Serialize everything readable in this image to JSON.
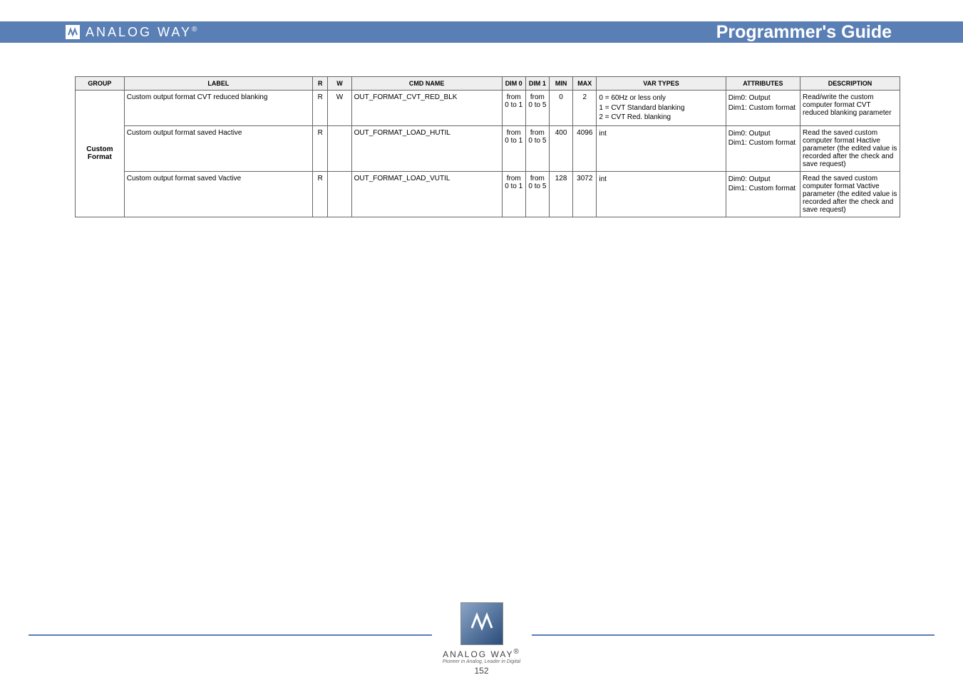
{
  "header": {
    "brand": "ANALOG WAY",
    "brand_reg": "®",
    "title": "Programmer's Guide"
  },
  "table": {
    "headers": {
      "group": "GROUP",
      "label": "LABEL",
      "r": "R",
      "w": "W",
      "cmd": "CMD NAME",
      "dim0": "DIM 0",
      "dim1": "DIM 1",
      "min": "MIN",
      "max": "MAX",
      "types": "VAR TYPES",
      "attr": "ATTRIBUTES",
      "desc": "DESCRIPTION"
    },
    "group_label": "Custom Format",
    "rows": [
      {
        "label": "Custom output format  CVT reduced blanking",
        "r": "R",
        "w": "W",
        "cmd": "OUT_FORMAT_CVT_RED_BLK",
        "dim0": "from 0 to 1",
        "dim1": "from 0 to 5",
        "min": "0",
        "max": "2",
        "types": "0 = 60Hz or less only\n1 = CVT Standard blanking\n2 = CVT Red. blanking",
        "attr": "Dim0: Output\nDim1: Custom format",
        "desc": "Read/write the custom computer format CVT reduced blanking parameter"
      },
      {
        "label": "Custom output format saved Hactive",
        "r": "R",
        "w": "",
        "cmd": "OUT_FORMAT_LOAD_HUTIL",
        "dim0": "from 0 to 1",
        "dim1": "from 0 to 5",
        "min": "400",
        "max": "4096",
        "types": "int",
        "attr": "Dim0: Output\nDim1: Custom format",
        "desc": "Read the saved custom computer format Hactive parameter (the edited value is recorded after the check and save request)"
      },
      {
        "label": "Custom output format saved Vactive",
        "r": "R",
        "w": "",
        "cmd": "OUT_FORMAT_LOAD_VUTIL",
        "dim0": "from 0 to 1",
        "dim1": "from 0 to 5",
        "min": "128",
        "max": "3072",
        "types": "int",
        "attr": "Dim0: Output\nDim1: Custom format",
        "desc": "Read the saved custom computer format Vactive parameter (the edited value is recorded after the check and save request)"
      }
    ]
  },
  "footer": {
    "brand": "ANALOG WAY",
    "brand_reg": "®",
    "tagline": "Pioneer in Analog, Leader in Digital",
    "page": "152"
  }
}
